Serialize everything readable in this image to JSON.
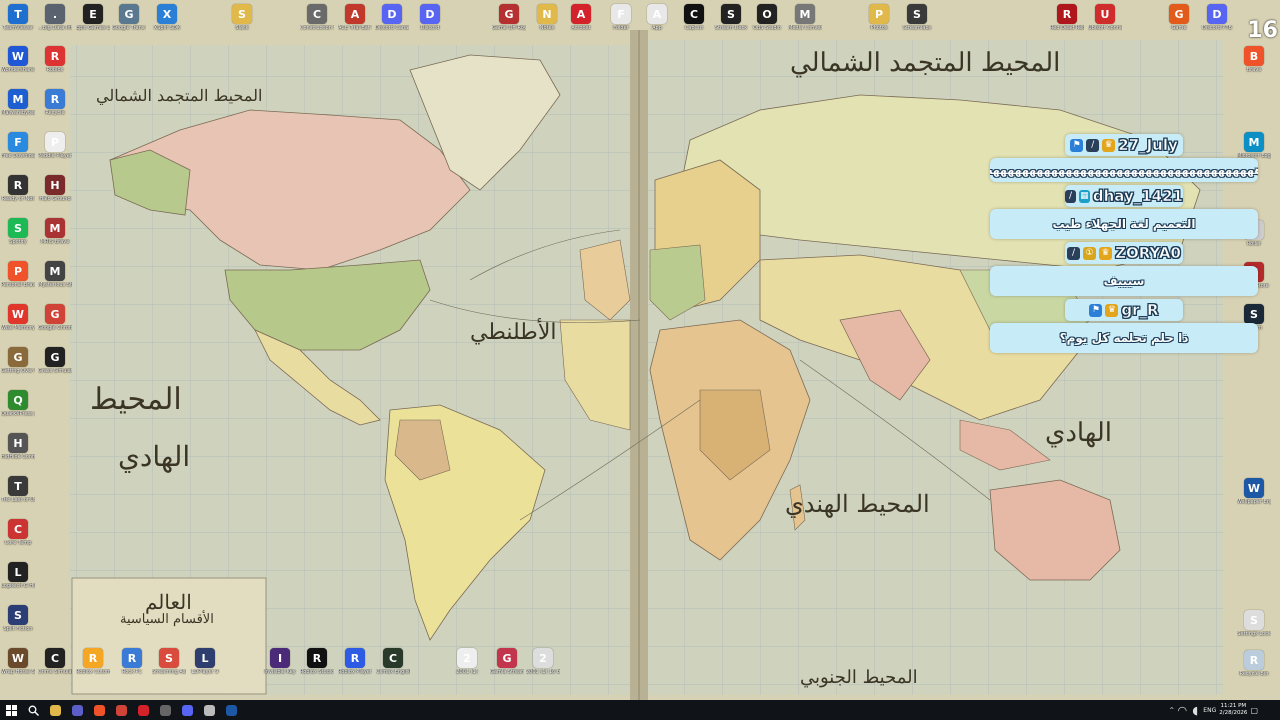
{
  "desktop": {
    "top_row_left": [
      {
        "label": "TeamViewer",
        "icon": "teamviewer-icon",
        "color": "#1e6fd0"
      },
      {
        "label": "...Big Data Infect Down",
        "icon": "app-icon",
        "color": "#5a6270"
      },
      {
        "label": "Epic Games Launcher",
        "icon": "epic-games-icon",
        "color": "#222"
      },
      {
        "label": "Google Trans Wreck",
        "icon": "app-icon",
        "color": "#5a7890"
      },
      {
        "label": "XSplit SDK",
        "icon": "app-icon",
        "color": "#2a7fd6"
      },
      {
        "label": "Slack",
        "icon": "folder-icon",
        "color": "#e1b84a"
      },
      {
        "label": "Construction Simulator",
        "icon": "game-icon",
        "color": "#6a6a6a"
      },
      {
        "label": "ACE Trial Bat Tool",
        "icon": "app-icon",
        "color": "#c0392b"
      },
      {
        "label": "Discord Canary",
        "icon": "discord-icon",
        "color": "#5865f2"
      },
      {
        "label": "Discord",
        "icon": "discord-icon",
        "color": "#5865f2"
      },
      {
        "label": "Game Off Roy People",
        "icon": "game-icon",
        "color": "#b53030"
      },
      {
        "label": "Notes",
        "icon": "folder-icon",
        "color": "#e1b84a"
      },
      {
        "label": "Acrobat",
        "icon": "acrobat-icon",
        "color": "#d4222b"
      },
      {
        "label": "Folder",
        "icon": "folder-icon",
        "color": "#e8e8e8"
      }
    ],
    "top_row_right": [
      {
        "label": "App",
        "icon": "app-icon",
        "color": "#e8e8e8"
      },
      {
        "label": "CapCut",
        "icon": "capcut-icon",
        "color": "#111"
      },
      {
        "label": "Stream Deck",
        "icon": "stream-deck-icon",
        "color": "#222"
      },
      {
        "label": "OBS Studio",
        "icon": "obs-icon",
        "color": "#222"
      },
      {
        "label": "Media Converter",
        "icon": "app-icon",
        "color": "#777"
      },
      {
        "label": "Photos",
        "icon": "folder-icon",
        "color": "#e1b84a"
      },
      {
        "label": "Streamlabs",
        "icon": "chat-icon",
        "color": "#3a3a3a"
      },
      {
        "label": "Red Dead Redemption 2",
        "icon": "game-icon",
        "color": "#b0171d"
      },
      {
        "label": "Ubisoft Connect",
        "icon": "app-icon",
        "color": "#d12c2c"
      },
      {
        "label": "Game",
        "icon": "game-icon",
        "color": "#e35b1b"
      },
      {
        "label": "Discord PTB",
        "icon": "discord-icon",
        "color": "#5865f2"
      },
      {
        "label": "Notes",
        "icon": "app-icon",
        "color": "#4aa36b"
      }
    ],
    "left_column": [
      {
        "label": "Wondershare PDFelement",
        "icon": "pdf-icon",
        "color": "#1f57d6"
      },
      {
        "label": "Malwarebytes",
        "icon": "malwarebytes-icon",
        "color": "#1d5fd1"
      },
      {
        "label": "Free Download Manager",
        "icon": "download-icon",
        "color": "#2a8ae0"
      },
      {
        "label": "Ready or Not",
        "icon": "game-icon",
        "color": "#333"
      },
      {
        "label": "Spotify",
        "icon": "spotify-icon",
        "color": "#1db954"
      },
      {
        "label": "Personal Brave",
        "icon": "brave-icon",
        "color": "#f0532a"
      },
      {
        "label": "Wise Memory",
        "icon": "app-icon",
        "color": "#e0362c"
      },
      {
        "label": "Getting Over It with Ben",
        "icon": "game-icon",
        "color": "#8a6a3a"
      },
      {
        "label": "QuarkXPress Zone",
        "icon": "app-icon",
        "color": "#2e8b2e"
      },
      {
        "label": "HidHide Configuration",
        "icon": "app-icon",
        "color": "#555"
      },
      {
        "label": "The Last of Us Part I",
        "icon": "game-icon",
        "color": "#3a3a3a"
      },
      {
        "label": "Core Temp",
        "icon": "app-icon",
        "color": "#c33"
      },
      {
        "label": "Logitech G HUB",
        "icon": "logitech-icon",
        "color": "#222"
      },
      {
        "label": "Split Fiction",
        "icon": "game-icon",
        "color": "#2b3d75"
      },
      {
        "label": "Wrap Horse Simulator",
        "icon": "game-icon",
        "color": "#6b4a2b"
      }
    ],
    "second_column": [
      {
        "label": "Roblox",
        "icon": "roblox-icon",
        "color": "#d33"
      },
      {
        "label": "Recycle",
        "icon": "app-icon",
        "color": "#3a7bd5"
      },
      {
        "label": "Paddle Player",
        "icon": "app-icon",
        "color": "#eee"
      },
      {
        "label": "Halo Ground",
        "icon": "game-icon",
        "color": "#7a2a2a"
      },
      {
        "label": "MRIS Brave",
        "icon": "app-icon",
        "color": "#a33"
      },
      {
        "label": "Mysterious Stone",
        "icon": "game-icon",
        "color": "#444"
      },
      {
        "label": "Google Chrome",
        "icon": "chrome-icon",
        "color": "#d04437"
      },
      {
        "label": "Grass Simulator",
        "icon": "game-icon",
        "color": "#222"
      }
    ],
    "right_column": [
      {
        "label": "Brave",
        "icon": "brave-icon",
        "color": "#f0532a"
      },
      {
        "label": "Microsoft Edge",
        "icon": "edge-icon",
        "color": "#0c8fc4"
      },
      {
        "label": "Roller",
        "icon": "app-icon",
        "color": "#ccc"
      },
      {
        "label": "Game Store",
        "icon": "game-icon",
        "color": "#b52a2a"
      },
      {
        "label": "Steam",
        "icon": "steam-icon",
        "color": "#1b2838"
      },
      {
        "label": "Wallpaper Engine",
        "icon": "wallpaper-engine-icon",
        "color": "#1d58a6"
      },
      {
        "label": "Settings Lock",
        "icon": "app-icon",
        "color": "#ddd"
      },
      {
        "label": "Recycle Bin",
        "icon": "recycle-bin-icon",
        "color": "#bcd"
      }
    ],
    "bottom_row": [
      {
        "label": "Crime Simulator",
        "icon": "game-icon",
        "color": "#222"
      },
      {
        "label": "Roblox Cutomizer",
        "icon": "roblox-icon",
        "color": "#f5a623"
      },
      {
        "label": "Rock PC",
        "icon": "app-icon",
        "color": "#3a7bd5"
      },
      {
        "label": "Streaming Assistant",
        "icon": "app-icon",
        "color": "#d94c3d"
      },
      {
        "label": "LDPlayer 9",
        "icon": "app-icon",
        "color": "#2e3e6e"
      },
      {
        "label": "Invisible Key",
        "icon": "app-icon",
        "color": "#4b2a7a"
      },
      {
        "label": "Roblox Studio",
        "icon": "roblox-icon",
        "color": "#111"
      },
      {
        "label": "Roblox Player",
        "icon": "roblox-icon",
        "color": "#2d5be3"
      },
      {
        "label": "Climax English",
        "icon": "app-icon",
        "color": "#2a3a2a"
      },
      {
        "label": "2001 (1)",
        "icon": "file-icon",
        "color": "#eee"
      },
      {
        "label": "Gamla Stream",
        "icon": "app-icon",
        "color": "#c2354c"
      },
      {
        "label": "2001 (1) 16 bit",
        "icon": "7zip-icon",
        "color": "#ddd"
      }
    ]
  },
  "map_labels": {
    "north_pacific": "المحيط المتجمد الشمالي",
    "north_atlantic": "المحيط المتجمد الشمالي",
    "pacific_left": "المحيط",
    "pacific_left2": "الهادي",
    "atlantic": "الأطلنطي",
    "indian": "المحيط الهندي",
    "pacific_right": "الهادي",
    "south": "المحيط الجنوبي",
    "legend_title": "العالم",
    "legend_sub": "الأقسام السياسية"
  },
  "chat": [
    {
      "user": "27_July",
      "badges": [
        "mod-badge",
        "sword-badge",
        "crown-badge"
      ],
      "text": "هههههههههههههههههههههههههههههههههههههه"
    },
    {
      "user": "dhay_1421",
      "badges": [
        "sword-badge",
        "grid-badge"
      ],
      "text": "التعميم لغة الجهلاء طيب"
    },
    {
      "user": "ZORYA0",
      "badges": [
        "sword-badge",
        "coin-badge",
        "crown-badge"
      ],
      "text": "سيييف"
    },
    {
      "user": "gr_R",
      "badges": [
        "mod-badge",
        "crown-badge"
      ],
      "text": "ذا حلم تحلمه كل يوم؟"
    }
  ],
  "overlay_counter": "16",
  "taskbar": {
    "pinned": [
      {
        "name": "start-button",
        "color": "#ffffff"
      },
      {
        "name": "search-icon",
        "color": "#ffffff"
      },
      {
        "name": "file-explorer-icon",
        "color": "#e1b84a"
      },
      {
        "name": "teams-icon",
        "color": "#5b5fc7"
      },
      {
        "name": "brave-icon",
        "color": "#f0532a"
      },
      {
        "name": "chrome-icon",
        "color": "#d04437"
      },
      {
        "name": "acrobat-icon",
        "color": "#d4222b"
      },
      {
        "name": "obs-icon",
        "color": "#666"
      },
      {
        "name": "discord-icon",
        "color": "#5865f2"
      },
      {
        "name": "settings-icon",
        "color": "#bbb"
      },
      {
        "name": "wallpaper-engine-icon",
        "color": "#1d58a6"
      }
    ],
    "language": "ENG",
    "time": "11:21 PM",
    "date": "2/28/2026"
  }
}
